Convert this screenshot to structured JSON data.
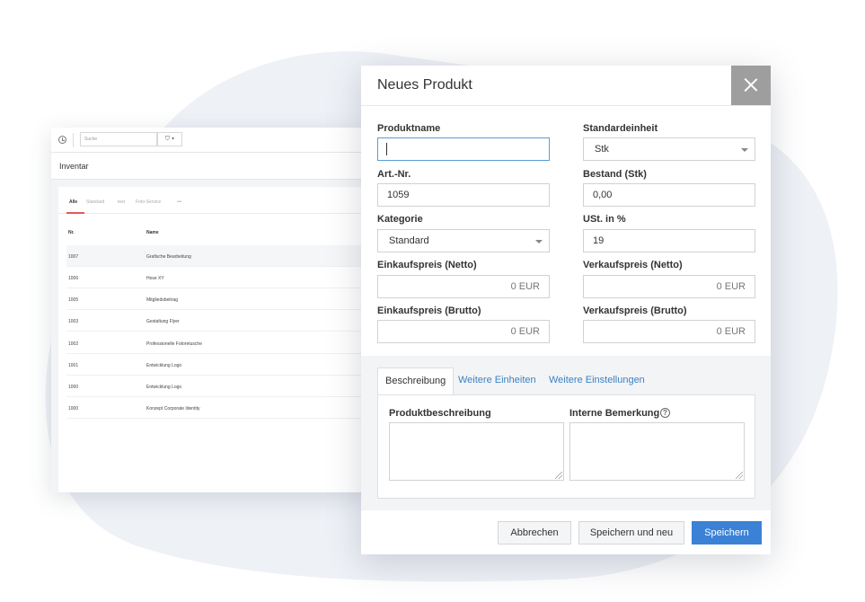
{
  "background": {
    "search_placeholder": "Suche",
    "filter_label": "▾",
    "title": "Inventar",
    "tabs": [
      "Alle",
      "Standard",
      "test",
      "Foto-Service",
      "•••"
    ],
    "columns": {
      "nr": "Nr.",
      "name": "Name"
    },
    "rows": [
      {
        "nr": "1007",
        "name": "Grafische Bearbeitung"
      },
      {
        "nr": "1006",
        "name": "Hose XY"
      },
      {
        "nr": "1005",
        "name": "Mitgliedsbeitrag"
      },
      {
        "nr": "1003",
        "name": "Gestaltung Flyer"
      },
      {
        "nr": "1002",
        "name": "Professionelle Fotoretusche"
      },
      {
        "nr": "1001",
        "name": "Entwicklung Logo"
      },
      {
        "nr": "1000",
        "name": "Entwicklung Logo"
      },
      {
        "nr": "1000",
        "name": "Konzept Corporate Identity"
      }
    ]
  },
  "modal": {
    "title": "Neues Produkt",
    "fields": {
      "produktname": {
        "label": "Produktname",
        "value": ""
      },
      "standardeinheit": {
        "label": "Standardeinheit",
        "value": "Stk"
      },
      "artnr": {
        "label": "Art.-Nr.",
        "value": "1059"
      },
      "bestand": {
        "label": "Bestand (Stk)",
        "value": "0,00"
      },
      "kategorie": {
        "label": "Kategorie",
        "value": "Standard"
      },
      "ust": {
        "label": "USt. in %",
        "value": "19"
      },
      "ek_netto": {
        "label": "Einkaufspreis (Netto)",
        "value": "0 EUR"
      },
      "vk_netto": {
        "label": "Verkaufspreis (Netto)",
        "value": "0 EUR"
      },
      "ek_brutto": {
        "label": "Einkaufspreis (Brutto)",
        "value": "0 EUR"
      },
      "vk_brutto": {
        "label": "Verkaufspreis (Brutto)",
        "value": "0 EUR"
      }
    },
    "tabs": [
      "Beschreibung",
      "Weitere Einheiten",
      "Weitere Einstellungen"
    ],
    "panel": {
      "produktbeschreibung_label": "Produktbeschreibung",
      "interne_bemerkung_label": "Interne Bemerkung",
      "info_glyph": "?"
    },
    "buttons": {
      "cancel": "Abbrechen",
      "save_new": "Speichern und neu",
      "save": "Speichern"
    }
  },
  "colors": {
    "accent": "#3b82d6",
    "link": "#3b82c4",
    "active_tab_underline": "#e05a5a",
    "close_button": "#9e9e9e",
    "blob": "#eef1f6"
  }
}
